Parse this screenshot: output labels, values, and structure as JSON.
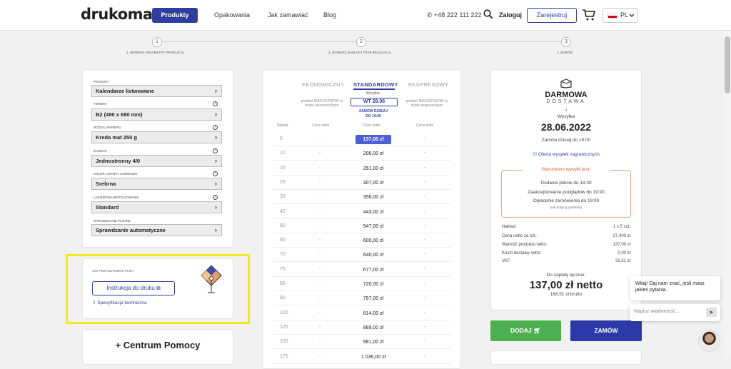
{
  "header": {
    "logo": "drukomat.",
    "nav": {
      "produkty": "Produkty",
      "opakowania": "Opakowania",
      "jak_zamawiac": "Jak zamawiać",
      "blog": "Blog"
    },
    "phone": "+48 222 111 222",
    "login": "Zaloguj",
    "register": "Zarejestruj",
    "lang": "PL"
  },
  "steps": [
    {
      "num": "1",
      "label": "1. Wybierz parametry produktu"
    },
    {
      "num": "2",
      "label": "2. Wybierz nakład i tryb realizacji"
    },
    {
      "num": "3",
      "label": "3. Zamów"
    }
  ],
  "config": {
    "fields": [
      {
        "label": "Produkt",
        "value": "Kalendarze listwowane"
      },
      {
        "label": "Format",
        "value": "B2 (480 x 680 mm)"
      },
      {
        "label": "Rodzaj papieru",
        "value": "Kreda mat 250 g"
      },
      {
        "label": "Zadruk",
        "value": "Jednostronny 4/0"
      },
      {
        "label": "Kolor listwy i zawieszki",
        "value": "Srebrna"
      },
      {
        "label": "Lakierowanie/foliowanie",
        "value": "Standard"
      },
      {
        "label": "Sprawdzanie plików",
        "value": "Sprawdzanie automatyczne"
      }
    ]
  },
  "prepare": {
    "heading": "Jak przygotować plik?",
    "button": "Instrukcja do druku",
    "spec": "Specyfikacja techniczna"
  },
  "help": {
    "title": "+ Centrum Pomocy"
  },
  "pricing": {
    "tabs": {
      "eco": "Ekonomiczny",
      "std": "Standardowy",
      "exp": "Ekspresowy"
    },
    "eco_note": "produkt NIEDOSTĘPNY w trybie ekonomicznym",
    "exp_note": "produkt NIEDOSTĘPNY w trybie ekspresowym",
    "wysylka": "Wysyłka:",
    "date": "WT 28.06",
    "order_today": "ZAMÓW DZISIAJ",
    "until": "DO 19:00",
    "col_naklad": "Nakład",
    "col_netto": "Cena netto",
    "dash": "-",
    "rows": [
      {
        "qty": "5",
        "price": "137,00 zł"
      },
      {
        "qty": "10",
        "price": "206,00 zł"
      },
      {
        "qty": "20",
        "price": "251,00 zł"
      },
      {
        "qty": "25",
        "price": "307,00 zł"
      },
      {
        "qty": "30",
        "price": "356,00 zł"
      },
      {
        "qty": "40",
        "price": "443,00 zł"
      },
      {
        "qty": "50",
        "price": "547,00 zł"
      },
      {
        "qty": "60",
        "price": "600,00 zł"
      },
      {
        "qty": "70",
        "price": "640,00 zł"
      },
      {
        "qty": "75",
        "price": "677,00 zł"
      },
      {
        "qty": "80",
        "price": "720,00 zł"
      },
      {
        "qty": "90",
        "price": "757,00 zł"
      },
      {
        "qty": "100",
        "price": "814,00 zł"
      },
      {
        "qty": "125",
        "price": "889,00 zł"
      },
      {
        "qty": "150",
        "price": "981,00 zł"
      },
      {
        "qty": "175",
        "price": "1 036,00 zł"
      }
    ]
  },
  "summary": {
    "free": "DARMOWA",
    "delivery": "DOSTAWA",
    "wysylka": "Wysyłka",
    "date": "28.06.2022",
    "order_until": "Zamów dzisiaj do 19:00",
    "foreign": "Oferta wysyłek zagranicznych",
    "conditions_title": "Warunkiem wysyłki jest:",
    "cond1": "Dodanie plików do 18:30",
    "cond2": "Zaakceptowanie podglądów do 19:00",
    "cond3": "Opłacenie zamówienia do 19:00",
    "cond_note": "(nie dotyczy pobrania)",
    "lines": [
      {
        "label": "Nakład:",
        "value": "1 x 5 szt."
      },
      {
        "label": "Cena netto za szt.:",
        "value": "27,400 zł"
      },
      {
        "label": "Wartość produktu netto:",
        "value": "137,00 zł"
      },
      {
        "label": "Koszt dostawy netto:",
        "value": "0,00 zł"
      },
      {
        "label": "VAT:",
        "value": "31,51 zł"
      }
    ],
    "to_pay": "Do zapłaty łącznie:",
    "total": "137,00 zł netto",
    "brutto": "168,51 zł brutto",
    "dodaj": "DODAJ",
    "zamow": "ZAMÓW"
  },
  "chat": {
    "message": "Witaj! Daj nam znać, jeśli masz jakieś pytania.",
    "placeholder": "Napisz wiadomość..."
  }
}
